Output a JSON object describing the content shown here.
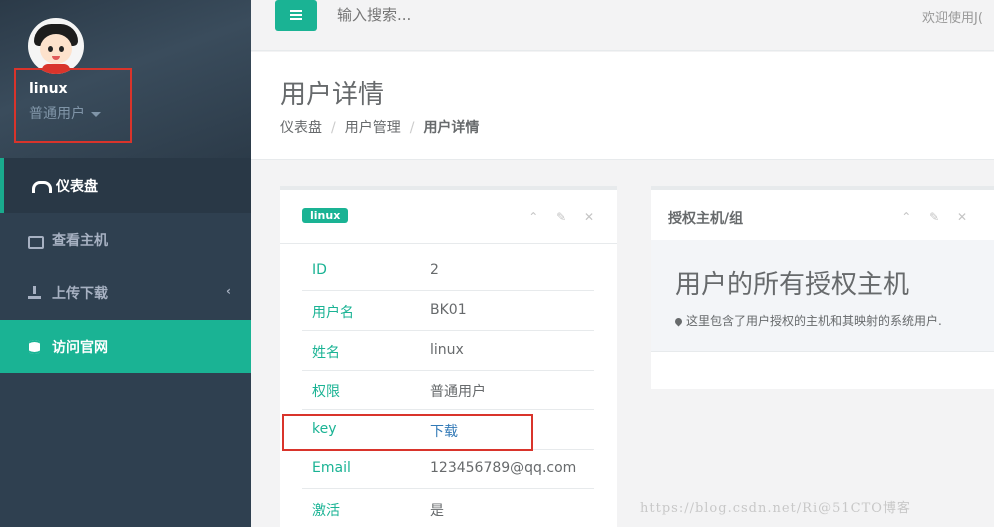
{
  "sidebar": {
    "username": "linux",
    "role": "普通用户",
    "items": [
      {
        "label": "仪表盘",
        "icon": "dashboard-icon"
      },
      {
        "label": "查看主机",
        "icon": "hdd-icon"
      },
      {
        "label": "上传下载",
        "icon": "download-icon"
      },
      {
        "label": "访问官网",
        "icon": "database-icon"
      }
    ],
    "chevron": "‹"
  },
  "topbar": {
    "search_placeholder": "输入搜索...",
    "welcome": "欢迎使用J("
  },
  "page": {
    "title": "用户详情",
    "breadcrumb": [
      "仪表盘",
      "用户管理",
      "用户详情"
    ],
    "separator": "/"
  },
  "user_panel": {
    "badge": "linux",
    "tools": "⌃ ✎ ✕",
    "rows": [
      {
        "key": "ID",
        "value": "2"
      },
      {
        "key": "用户名",
        "value": "BK01"
      },
      {
        "key": "姓名",
        "value": "linux"
      },
      {
        "key": "权限",
        "value": "普通用户"
      },
      {
        "key": "key",
        "value": "下载"
      },
      {
        "key": "Email",
        "value": "123456789@qq.com"
      },
      {
        "key": "激活",
        "value": "是"
      }
    ]
  },
  "hosts_panel": {
    "title": "授权主机/组",
    "tools": "⌃ ✎ ✕",
    "heading": "用户的所有授权主机",
    "description": "这里包含了用户授权的主机和其映射的系统用户."
  },
  "watermark": "https://blog.csdn.net/Ri@51CTO博客",
  "colors": {
    "accent": "#1ab394",
    "sidebar": "#2f4050",
    "highlight": "#d9342b",
    "link": "#337ab7"
  }
}
